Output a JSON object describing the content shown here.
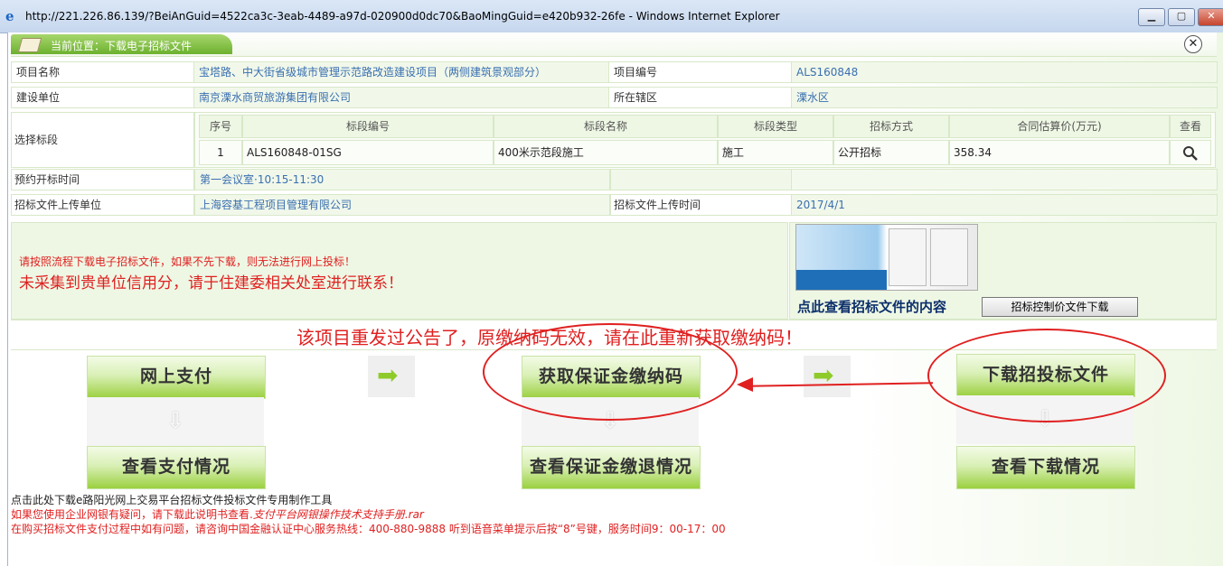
{
  "window": {
    "title": "http://221.226.86.139/?BeiAnGuid=4522ca3c-3eab-4489-a97d-020900d0dc70&BaoMingGuid=e420b932-26fe - Windows Internet Explorer",
    "minimize": "▁",
    "maximize": "▢",
    "close": "✕"
  },
  "breadcrumb": {
    "text": "当前位置：下载电子招标文件",
    "close": "✕"
  },
  "info": {
    "project_name_label": "项目名称",
    "project_name": "宝塔路、中大街省级城市管理示范路改造建设项目（两侧建筑景观部分）",
    "project_no_label": "项目编号",
    "project_no": "ALS160848",
    "builder_label": "建设单位",
    "builder": "南京溧水商贸旅游集团有限公司",
    "district_label": "所在辖区",
    "district": "溧水区",
    "section_label": "选择标段",
    "open_time_label": "预约开标时间",
    "open_time": "第一会议室·10:15-11:30",
    "uploader_label": "招标文件上传单位",
    "uploader": "上海容基工程项目管理有限公司",
    "upload_time_label": "招标文件上传时间",
    "upload_time": "2017/4/1"
  },
  "sections_table": {
    "headers": [
      "序号",
      "标段编号",
      "标段名称",
      "标段类型",
      "招标方式",
      "合同估算价(万元)",
      "查看"
    ],
    "rows": [
      {
        "no": "1",
        "code": "ALS160848-01SG",
        "name": "400米示范段施工",
        "type": "施工",
        "method": "公开招标",
        "price": "358.34",
        "view_icon": "search-icon"
      }
    ]
  },
  "messages": {
    "line1": "请按照流程下载电子招标文件，如果不先下载，则无法进行网上投标！",
    "line2": "未采集到贵单位信用分，请于住建委相关处室进行联系！"
  },
  "preview": {
    "caption": "点此查看招标文件的内容",
    "download_button": "招标控制价文件下载"
  },
  "notice": "该项目重发过公告了，原缴纳码无效，请在此重新获取缴纳码！",
  "flow": {
    "pay_online": "网上支付",
    "get_code": "获取保证金缴纳码",
    "download_docs": "下载招投标文件",
    "view_payment": "查看支付情况",
    "view_deposit_refund": "查看保证金缴退情况",
    "view_download": "查看下载情况",
    "arrow_right": "➡",
    "arrow_down": "⇩"
  },
  "footer": {
    "line1": "点击此处下载e路阳光网上交易平台招标文件投标文件专用制作工具",
    "line2_prefix": "如果您使用企业网银有疑问，请下载此说明书查看.",
    "line2_link": "支付平台网银操作技术支持手册.rar",
    "line3": "在购买招标文件支付过程中如有问题，请咨询中国金融认证中心服务热线：400-880-9888 听到语音菜单提示后按“8”号键，服务时间9：00-17：00"
  },
  "colors": {
    "accent_green": "#6cb12e",
    "alert_red": "#e02020",
    "link_blue": "#3a6fb0"
  }
}
